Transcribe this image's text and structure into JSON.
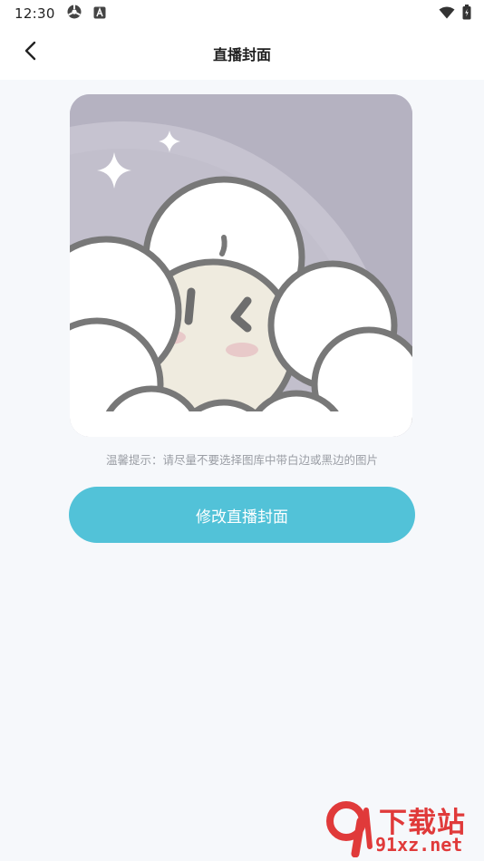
{
  "status_bar": {
    "time": "12:30",
    "icons_left": [
      "settings-gear-icon",
      "keyboard-a-icon"
    ],
    "icons_right": [
      "wifi-icon",
      "battery-icon"
    ]
  },
  "header": {
    "back_icon": "chevron-left-icon",
    "title": "直播封面"
  },
  "cover": {
    "image_desc_icon": "cover-image"
  },
  "tip": "温馨提示：请尽量不要选择图库中带白边或黑边的图片",
  "button": {
    "label": "修改直播封面"
  },
  "watermark": {
    "top": "下载站",
    "bottom": "91xz.net"
  },
  "colors": {
    "accent": "#52c2d8",
    "background": "#f6f8fb",
    "tip": "#9b9ea5",
    "watermark": "#e03a3a"
  }
}
